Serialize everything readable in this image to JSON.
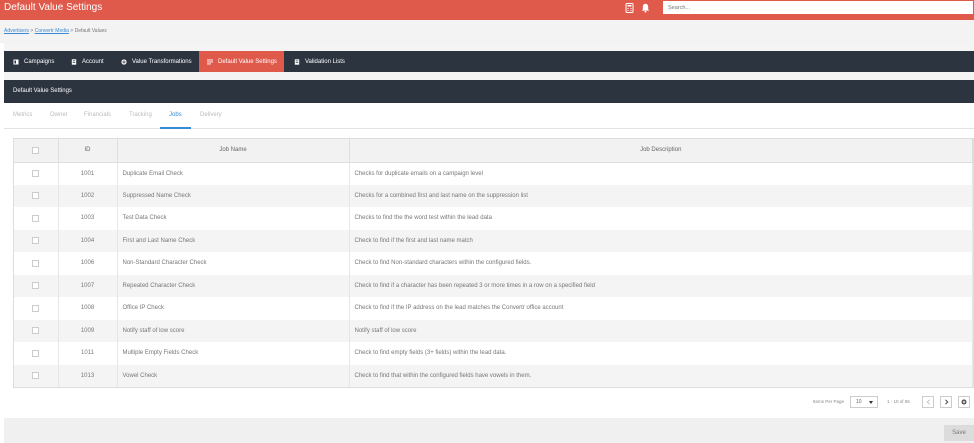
{
  "header": {
    "title": "Default Value Settings",
    "search_placeholder": "Search...",
    "icons": [
      "calculator-icon",
      "bell-icon"
    ],
    "accent_color": "#e05a4c"
  },
  "breadcrumb": {
    "items": [
      "Advertisers",
      "Convertr Media"
    ],
    "current": "Default Values",
    "separator": ">"
  },
  "main_tabs": [
    {
      "label": "Campaigns",
      "icon": "campaign-icon",
      "active": false
    },
    {
      "label": "Account",
      "icon": "account-icon",
      "active": false
    },
    {
      "label": "Value Transformations",
      "icon": "gear-icon",
      "active": false
    },
    {
      "label": "Default Value Settings",
      "icon": "list-icon",
      "active": true
    },
    {
      "label": "Validation Lists",
      "icon": "document-icon",
      "active": false
    }
  ],
  "panel": {
    "title": "Default Value Settings",
    "subtabs": [
      {
        "label": "Metrics",
        "active": false
      },
      {
        "label": "Owner",
        "active": false
      },
      {
        "label": "Financials",
        "active": false
      },
      {
        "label": "Tracking",
        "active": false
      },
      {
        "label": "Jobs",
        "active": true
      },
      {
        "label": "Delivery",
        "active": false
      }
    ]
  },
  "table": {
    "columns": [
      "",
      "ID",
      "Job Name",
      "Job Description"
    ],
    "rows": [
      {
        "id": "1001",
        "name": "Duplicate Email Check",
        "description": "Checks for duplicate emails on a campaign level"
      },
      {
        "id": "1002",
        "name": "Suppressed Name Check",
        "description": "Checks for a combined first and last name on the suppression list"
      },
      {
        "id": "1003",
        "name": "Test Data Check",
        "description": "Checks to find the the word test within the lead data"
      },
      {
        "id": "1004",
        "name": "First and Last Name Check",
        "description": "Check to find if the first and last name match"
      },
      {
        "id": "1006",
        "name": "Non-Standard Character Check",
        "description": "Check to find Non-standard characters within the configured fields."
      },
      {
        "id": "1007",
        "name": "Repeated Character Check",
        "description": "Check to find if a character has been repeated 3 or more times in a row on a specified field"
      },
      {
        "id": "1008",
        "name": "Office IP Check",
        "description": "Check to find if the IP address on the lead matches the Convertr office account"
      },
      {
        "id": "1009",
        "name": "Notify staff of low score",
        "description": "Notify staff of low score"
      },
      {
        "id": "1011",
        "name": "Multiple Empty Fields Check",
        "description": "Check to find empty fields (3+ fields) within the lead data."
      },
      {
        "id": "1013",
        "name": "Vowel Check",
        "description": "Check to find that within the configured fields have vowels in them."
      }
    ]
  },
  "pagination": {
    "items_per_page_label": "Items Per Page",
    "items_per_page": "10",
    "range": "1 - 10 of 55"
  },
  "footer": {
    "save_label": "Save"
  }
}
